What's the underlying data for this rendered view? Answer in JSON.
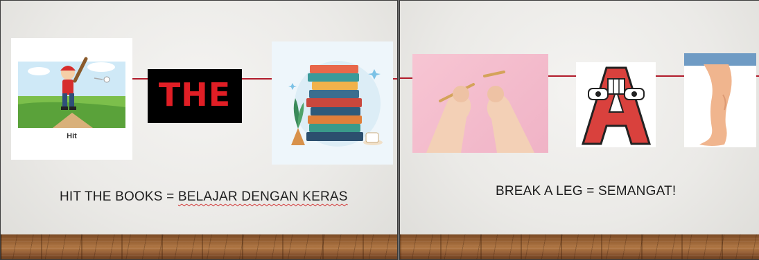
{
  "slides": [
    {
      "caption_prefix": "HIT THE BOOKS = ",
      "caption_underlined": "BELAJAR DENGAN KERAS",
      "hit_card_label": "Hit",
      "the_box_text": "THE"
    },
    {
      "caption": "BREAK A LEG = SEMANGAT!"
    }
  ],
  "colors": {
    "accent_line": "#b11a2a",
    "the_text": "#e01e25",
    "the_box_bg": "#000000",
    "letter_a": "#d9413d"
  },
  "icons": [
    "baseball-hitter-image",
    "stacked-books-image",
    "breaking-breadstick-hands-image",
    "letter-a-character-image",
    "leg-image"
  ]
}
